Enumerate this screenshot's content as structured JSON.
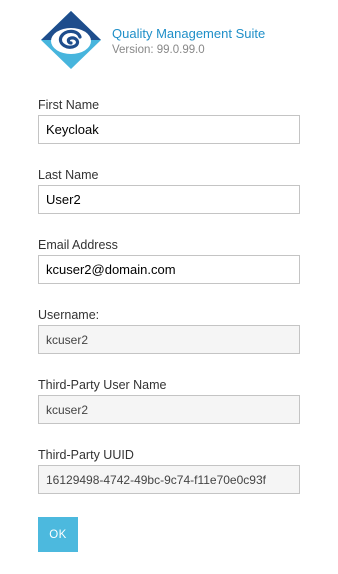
{
  "header": {
    "app_title": "Quality Management Suite",
    "version": "Version: 99.0.99.0",
    "logo_icon": "eye-swirl-diamond-logo"
  },
  "form": {
    "first_name": {
      "label": "First Name",
      "value": "Keycloak"
    },
    "last_name": {
      "label": "Last Name",
      "value": "User2"
    },
    "email": {
      "label": "Email Address",
      "value": "kcuser2@domain.com"
    },
    "username": {
      "label": "Username:",
      "value": "kcuser2"
    },
    "third_party_username": {
      "label": "Third-Party User Name",
      "value": "kcuser2"
    },
    "third_party_uuid": {
      "label": "Third-Party UUID",
      "value": "16129498-4742-49bc-9c74-f11e70e0c93f"
    }
  },
  "actions": {
    "ok_label": "OK"
  },
  "colors": {
    "accent": "#1f8fc8",
    "button": "#4cb9de",
    "logo_dark": "#1e4d8c",
    "logo_light": "#47b5dd"
  }
}
